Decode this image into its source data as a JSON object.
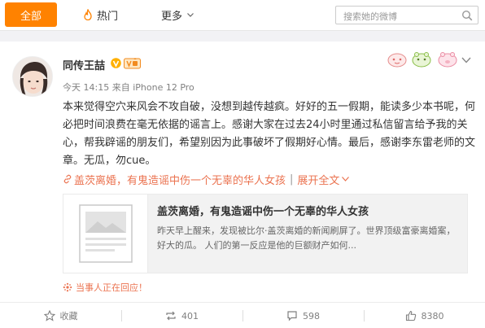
{
  "filter_bar": {
    "all_label": "全部",
    "hot_label": "热门",
    "more_label": "更多",
    "search_placeholder": "搜索她的微博"
  },
  "post": {
    "author": "同传王喆",
    "time": "今天 14:15",
    "source_prefix": "来自",
    "source": "iPhone 12 Pro",
    "text": "本来觉得空穴来风会不攻自破，没想到越传越疯。好好的五一假期，能读多少本书呢，何必把时间浪费在毫无依据的谣言上。感谢大家在过去24小时里通过私信留言给予我的关心，帮我辟谣的朋友们，希望别因为此事破坏了假期好心情。最后，感谢李东雷老师的文章。无瓜，勿cue。",
    "topic_link": "盖茨离婚，有鬼造谣中伤一个无辜的华人女孩",
    "expand_label": "展开全文",
    "link_card": {
      "title": "盖茨离婚，有鬼造谣中伤一个无辜的华人女孩",
      "desc": "昨天早上醒来，发现被比尔·盖茨离婚的新闻刷屏了。世界顶级富豪离婚案，好大的瓜。 人们的第一反应是他的巨额财产如何..."
    },
    "responding": "当事人正在回应！",
    "actions": {
      "favorite": "收藏",
      "repost": "401",
      "comment": "598",
      "like": "8380"
    }
  },
  "colors": {
    "accent": "#ff8200",
    "link": "#eb7350"
  }
}
